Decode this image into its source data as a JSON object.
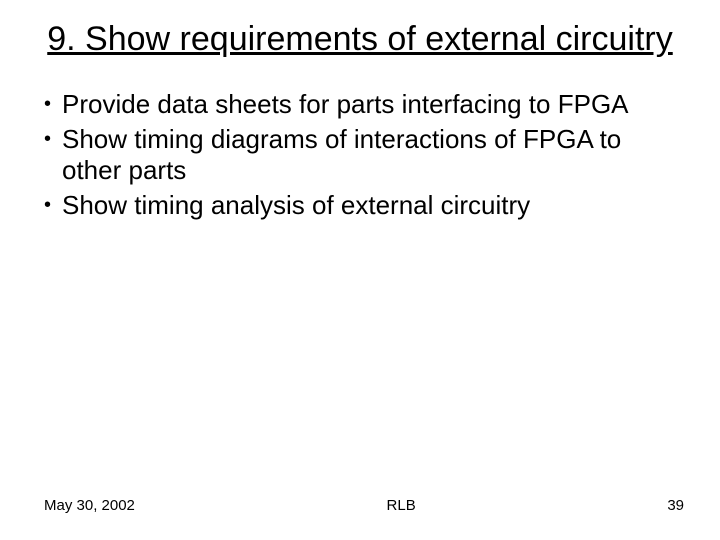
{
  "title": "9.  Show requirements of external circuitry",
  "bullets": [
    "Provide data sheets for parts interfacing to FPGA",
    "Show timing diagrams of interactions of FPGA to other parts",
    "Show timing analysis of external circuitry"
  ],
  "footer": {
    "date": "May 30, 2002",
    "center": "RLB",
    "page": "39"
  }
}
